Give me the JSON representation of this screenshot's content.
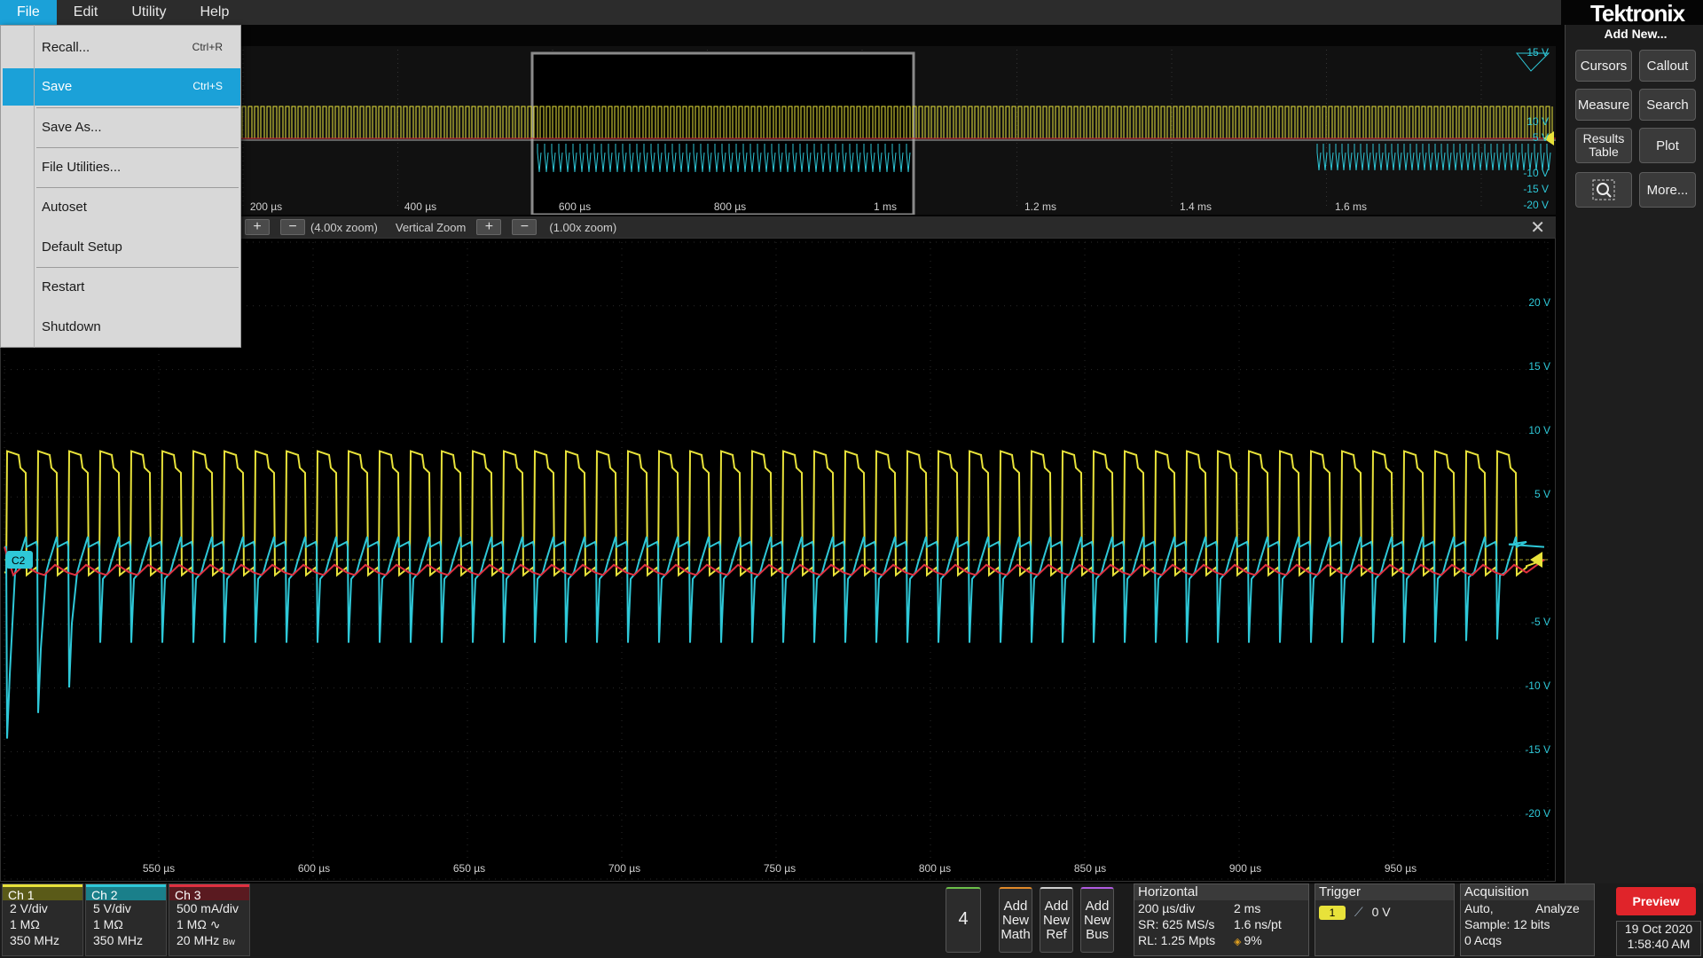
{
  "menubar": {
    "items": [
      "File",
      "Edit",
      "Utility",
      "Help"
    ]
  },
  "brand": "Tektronix",
  "file_menu": {
    "items": [
      {
        "label": "Recall...",
        "shortcut": "Ctrl+R"
      },
      {
        "label": "Save",
        "shortcut": "Ctrl+S"
      },
      {
        "label": "Save As...",
        "shortcut": ""
      },
      {
        "label": "File Utilities...",
        "shortcut": ""
      },
      {
        "label": "Autoset",
        "shortcut": ""
      },
      {
        "label": "Default Setup",
        "shortcut": ""
      },
      {
        "label": "Restart",
        "shortcut": ""
      },
      {
        "label": "Shutdown",
        "shortcut": ""
      }
    ],
    "selected": "Save"
  },
  "right_panel": {
    "title": "Add New...",
    "buttons": {
      "cursors": "Cursors",
      "callout": "Callout",
      "measure": "Measure",
      "search": "Search",
      "results_table": "Results Table",
      "plot": "Plot",
      "more": "More..."
    }
  },
  "overview": {
    "x_ticks": [
      "200 µs",
      "400 µs",
      "600 µs",
      "800 µs",
      "1 ms",
      "1.2 ms",
      "1.4 ms",
      "1.6 ms"
    ],
    "y_ticks": [
      "15 V",
      "10 V",
      "5 V",
      "-10 V",
      "-15 V",
      "-20 V"
    ]
  },
  "zoom_bar": {
    "horizontal_zoom": "(4.00x zoom)",
    "vertical_label": "Vertical Zoom",
    "vertical_zoom": "(1.00x zoom)"
  },
  "main_plot": {
    "y_ticks": [
      "20 V",
      "15 V",
      "10 V",
      "5 V",
      "-5 V",
      "-10 V",
      "-15 V",
      "-20 V"
    ],
    "x_ticks": [
      "550 µs",
      "600 µs",
      "650 µs",
      "700 µs",
      "750 µs",
      "800 µs",
      "850 µs",
      "900 µs",
      "950 µs"
    ],
    "channel_marker": "C2"
  },
  "channels": [
    {
      "name": "Ch 1",
      "scale": "2 V/div",
      "impedance": "1 MΩ",
      "bandwidth": "350 MHz",
      "color": "#e8e23a"
    },
    {
      "name": "Ch 2",
      "scale": "5 V/div",
      "impedance": "1 MΩ",
      "bandwidth": "350 MHz",
      "color": "#2ec8d8"
    },
    {
      "name": "Ch 3",
      "scale": "500 mA/div",
      "impedance": "1 MΩ",
      "bandwidth": "20 MHz",
      "color": "#e03040"
    }
  ],
  "channel_count_button": "4",
  "add_buttons": {
    "math": [
      "Add",
      "New",
      "Math"
    ],
    "ref": [
      "Add",
      "New",
      "Ref"
    ],
    "bus": [
      "Add",
      "New",
      "Bus"
    ]
  },
  "horizontal": {
    "title": "Horizontal",
    "scale": "200 µs/div",
    "duration": "2 ms",
    "sample_rate": "SR: 625 MS/s",
    "resolution": "1.6 ns/pt",
    "record_length": "RL: 1.25 Mpts",
    "position": "9%"
  },
  "trigger": {
    "title": "Trigger",
    "source": "1",
    "level": "0 V"
  },
  "acquisition": {
    "title": "Acquisition",
    "mode": "Auto,",
    "analyze": "Analyze",
    "sample": "Sample: 12 bits",
    "acqs": "0 Acqs"
  },
  "preview_button": "Preview",
  "date": "19 Oct 2020",
  "time": "1:58:40 AM"
}
